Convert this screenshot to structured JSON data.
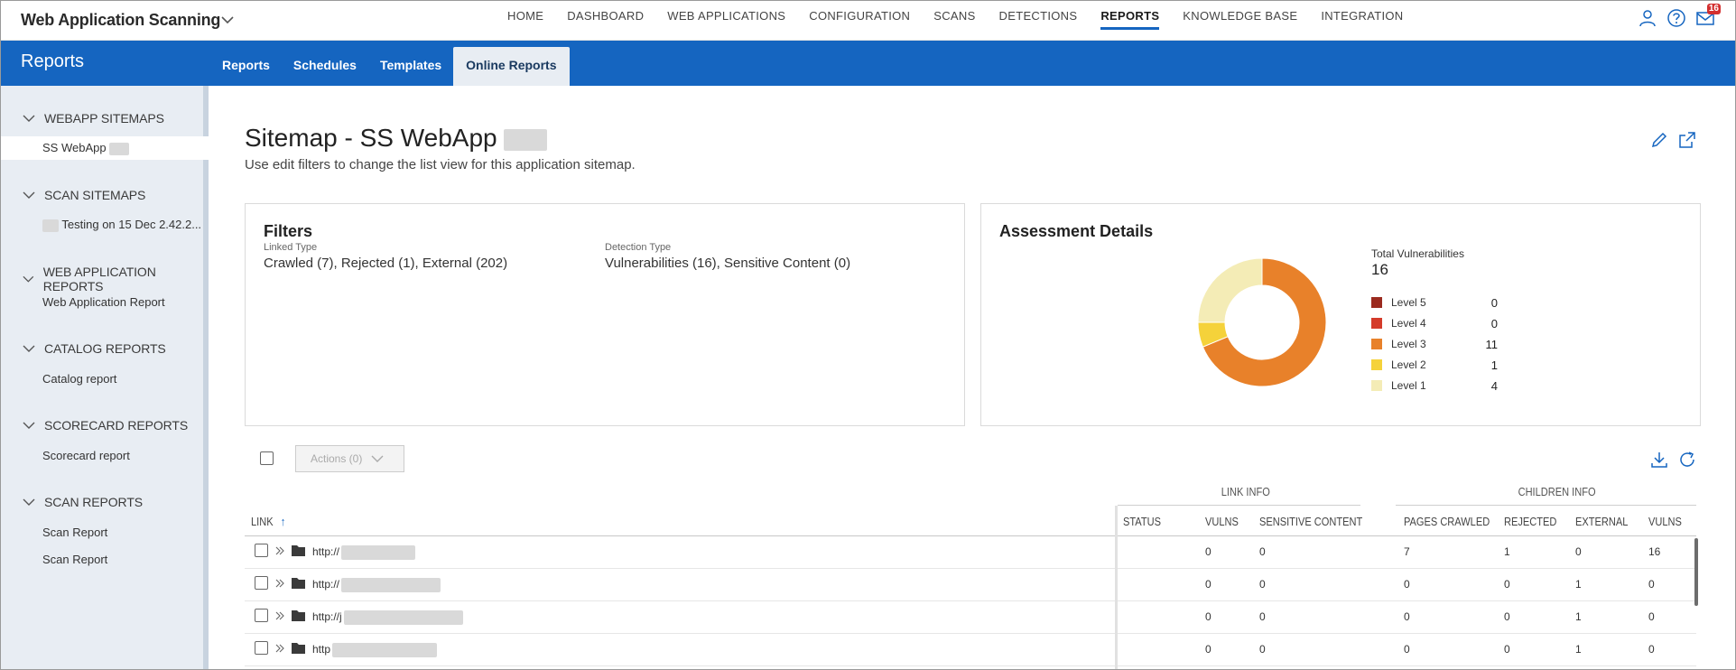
{
  "app": {
    "title": "Web Application Scanning"
  },
  "nav": [
    "HOME",
    "DASHBOARD",
    "WEB APPLICATIONS",
    "CONFIGURATION",
    "SCANS",
    "DETECTIONS",
    "REPORTS",
    "KNOWLEDGE BASE",
    "INTEGRATION"
  ],
  "nav_active": "REPORTS",
  "notifications": {
    "count": "16"
  },
  "subbar": {
    "title": "Reports",
    "tabs": [
      "Reports",
      "Schedules",
      "Templates",
      "Online Reports"
    ],
    "active_tab": "Online Reports"
  },
  "sidebar": [
    {
      "heading": "WEBAPP SITEMAPS",
      "items": [
        "SS WebApp"
      ]
    },
    {
      "heading": "SCAN SITEMAPS",
      "items": [
        "Testing on 15 Dec 2.42.2..."
      ]
    },
    {
      "heading": "WEB APPLICATION REPORTS",
      "items": [
        "Web Application Report"
      ]
    },
    {
      "heading": "CATALOG REPORTS",
      "items": [
        "Catalog report"
      ]
    },
    {
      "heading": "SCORECARD REPORTS",
      "items": [
        "Scorecard report"
      ]
    },
    {
      "heading": "SCAN REPORTS",
      "items": [
        "Scan Report",
        "Scan Report"
      ]
    }
  ],
  "page": {
    "title": "Sitemap - SS WebApp",
    "subtitle": "Use edit filters to change the list view for this application sitemap."
  },
  "filters": {
    "title": "Filters",
    "linked_type_label": "Linked Type",
    "linked_type_value": "Crawled (7),  Rejected (1),  External (202)",
    "detection_type_label": "Detection Type",
    "detection_type_value": "Vulnerabilities (16), Sensitive Content (0)"
  },
  "assessment": {
    "title": "Assessment Details",
    "total_label": "Total Vulnerabilities",
    "total": "16",
    "levels": [
      {
        "label": "Level 5",
        "value": 0,
        "color": "#9b2a1f"
      },
      {
        "label": "Level 4",
        "value": 0,
        "color": "#d43b2a"
      },
      {
        "label": "Level 3",
        "value": 11,
        "color": "#e8812a"
      },
      {
        "label": "Level 2",
        "value": 1,
        "color": "#f5d23a"
      },
      {
        "label": "Level 1",
        "value": 4,
        "color": "#f4ecb6"
      }
    ]
  },
  "toolbar": {
    "actions_label": "Actions (0)"
  },
  "table": {
    "group_link_info": "LINK INFO",
    "group_children_info": "CHILDREN INFO",
    "columns": {
      "link": "LINK",
      "status": "STATUS",
      "vulns": "VULNS",
      "sensitive": "SENSITIVE CONTENT",
      "pages_crawled": "PAGES CRAWLED",
      "rejected": "REJECTED",
      "external": "EXTERNAL",
      "child_vulns": "VULNS"
    },
    "rows": [
      {
        "link": "http://",
        "status": "",
        "vulns": "0",
        "sensitive": "0",
        "pages_crawled": "7",
        "rejected": "1",
        "external": "0",
        "child_vulns": "16"
      },
      {
        "link": "http://",
        "status": "",
        "vulns": "0",
        "sensitive": "0",
        "pages_crawled": "0",
        "rejected": "0",
        "external": "1",
        "child_vulns": "0"
      },
      {
        "link": "http://j",
        "status": "",
        "vulns": "0",
        "sensitive": "0",
        "pages_crawled": "0",
        "rejected": "0",
        "external": "1",
        "child_vulns": "0"
      },
      {
        "link": "http",
        "status": "",
        "vulns": "0",
        "sensitive": "0",
        "pages_crawled": "0",
        "rejected": "0",
        "external": "1",
        "child_vulns": "0"
      }
    ]
  }
}
